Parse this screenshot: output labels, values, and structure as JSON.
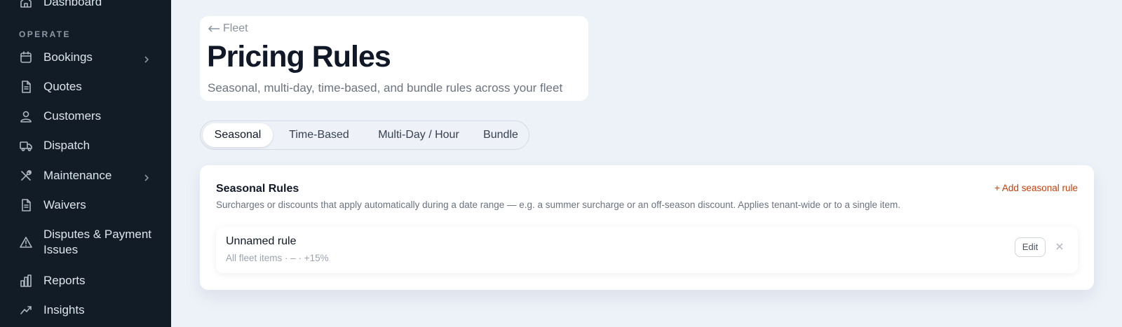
{
  "sidebar": {
    "top_item": {
      "label": "Dashboard",
      "icon": "home-icon"
    },
    "section_label": "OPERATE",
    "items": [
      {
        "label": "Bookings",
        "icon": "calendar-icon",
        "has_submenu": true
      },
      {
        "label": "Quotes",
        "icon": "document-icon",
        "has_submenu": false
      },
      {
        "label": "Customers",
        "icon": "users-icon",
        "has_submenu": false
      },
      {
        "label": "Dispatch",
        "icon": "truck-icon",
        "has_submenu": false
      },
      {
        "label": "Maintenance",
        "icon": "wrench-icon",
        "has_submenu": true
      },
      {
        "label": "Waivers",
        "icon": "document-icon",
        "has_submenu": false
      },
      {
        "label": "Disputes & Payment Issues",
        "icon": "warning-icon",
        "has_submenu": false
      },
      {
        "label": "Reports",
        "icon": "bar-chart-icon",
        "has_submenu": false
      },
      {
        "label": "Insights",
        "icon": "trend-icon",
        "has_submenu": false
      }
    ]
  },
  "header": {
    "back_label": "Fleet",
    "title": "Pricing Rules",
    "subtitle": "Seasonal, multi-day, time-based, and bundle rules across your fleet"
  },
  "tabs": [
    {
      "label": "Seasonal",
      "active": true
    },
    {
      "label": "Time-Based",
      "active": false
    },
    {
      "label": "Multi-Day / Hour",
      "active": false
    },
    {
      "label": "Bundle",
      "active": false
    }
  ],
  "rules_card": {
    "title": "Seasonal Rules",
    "description": "Surcharges or discounts that apply automatically during a date range — e.g. a summer surcharge or an off-season discount. Applies tenant-wide or to a single item.",
    "add_label": "+ Add seasonal rule",
    "rules": [
      {
        "name": "Unnamed rule",
        "meta": "All fleet items · – · +15%",
        "edit_label": "Edit"
      }
    ]
  },
  "colors": {
    "sidebar_bg": "#121c27",
    "page_bg": "#edf1f8",
    "accent": "#c2410c"
  }
}
